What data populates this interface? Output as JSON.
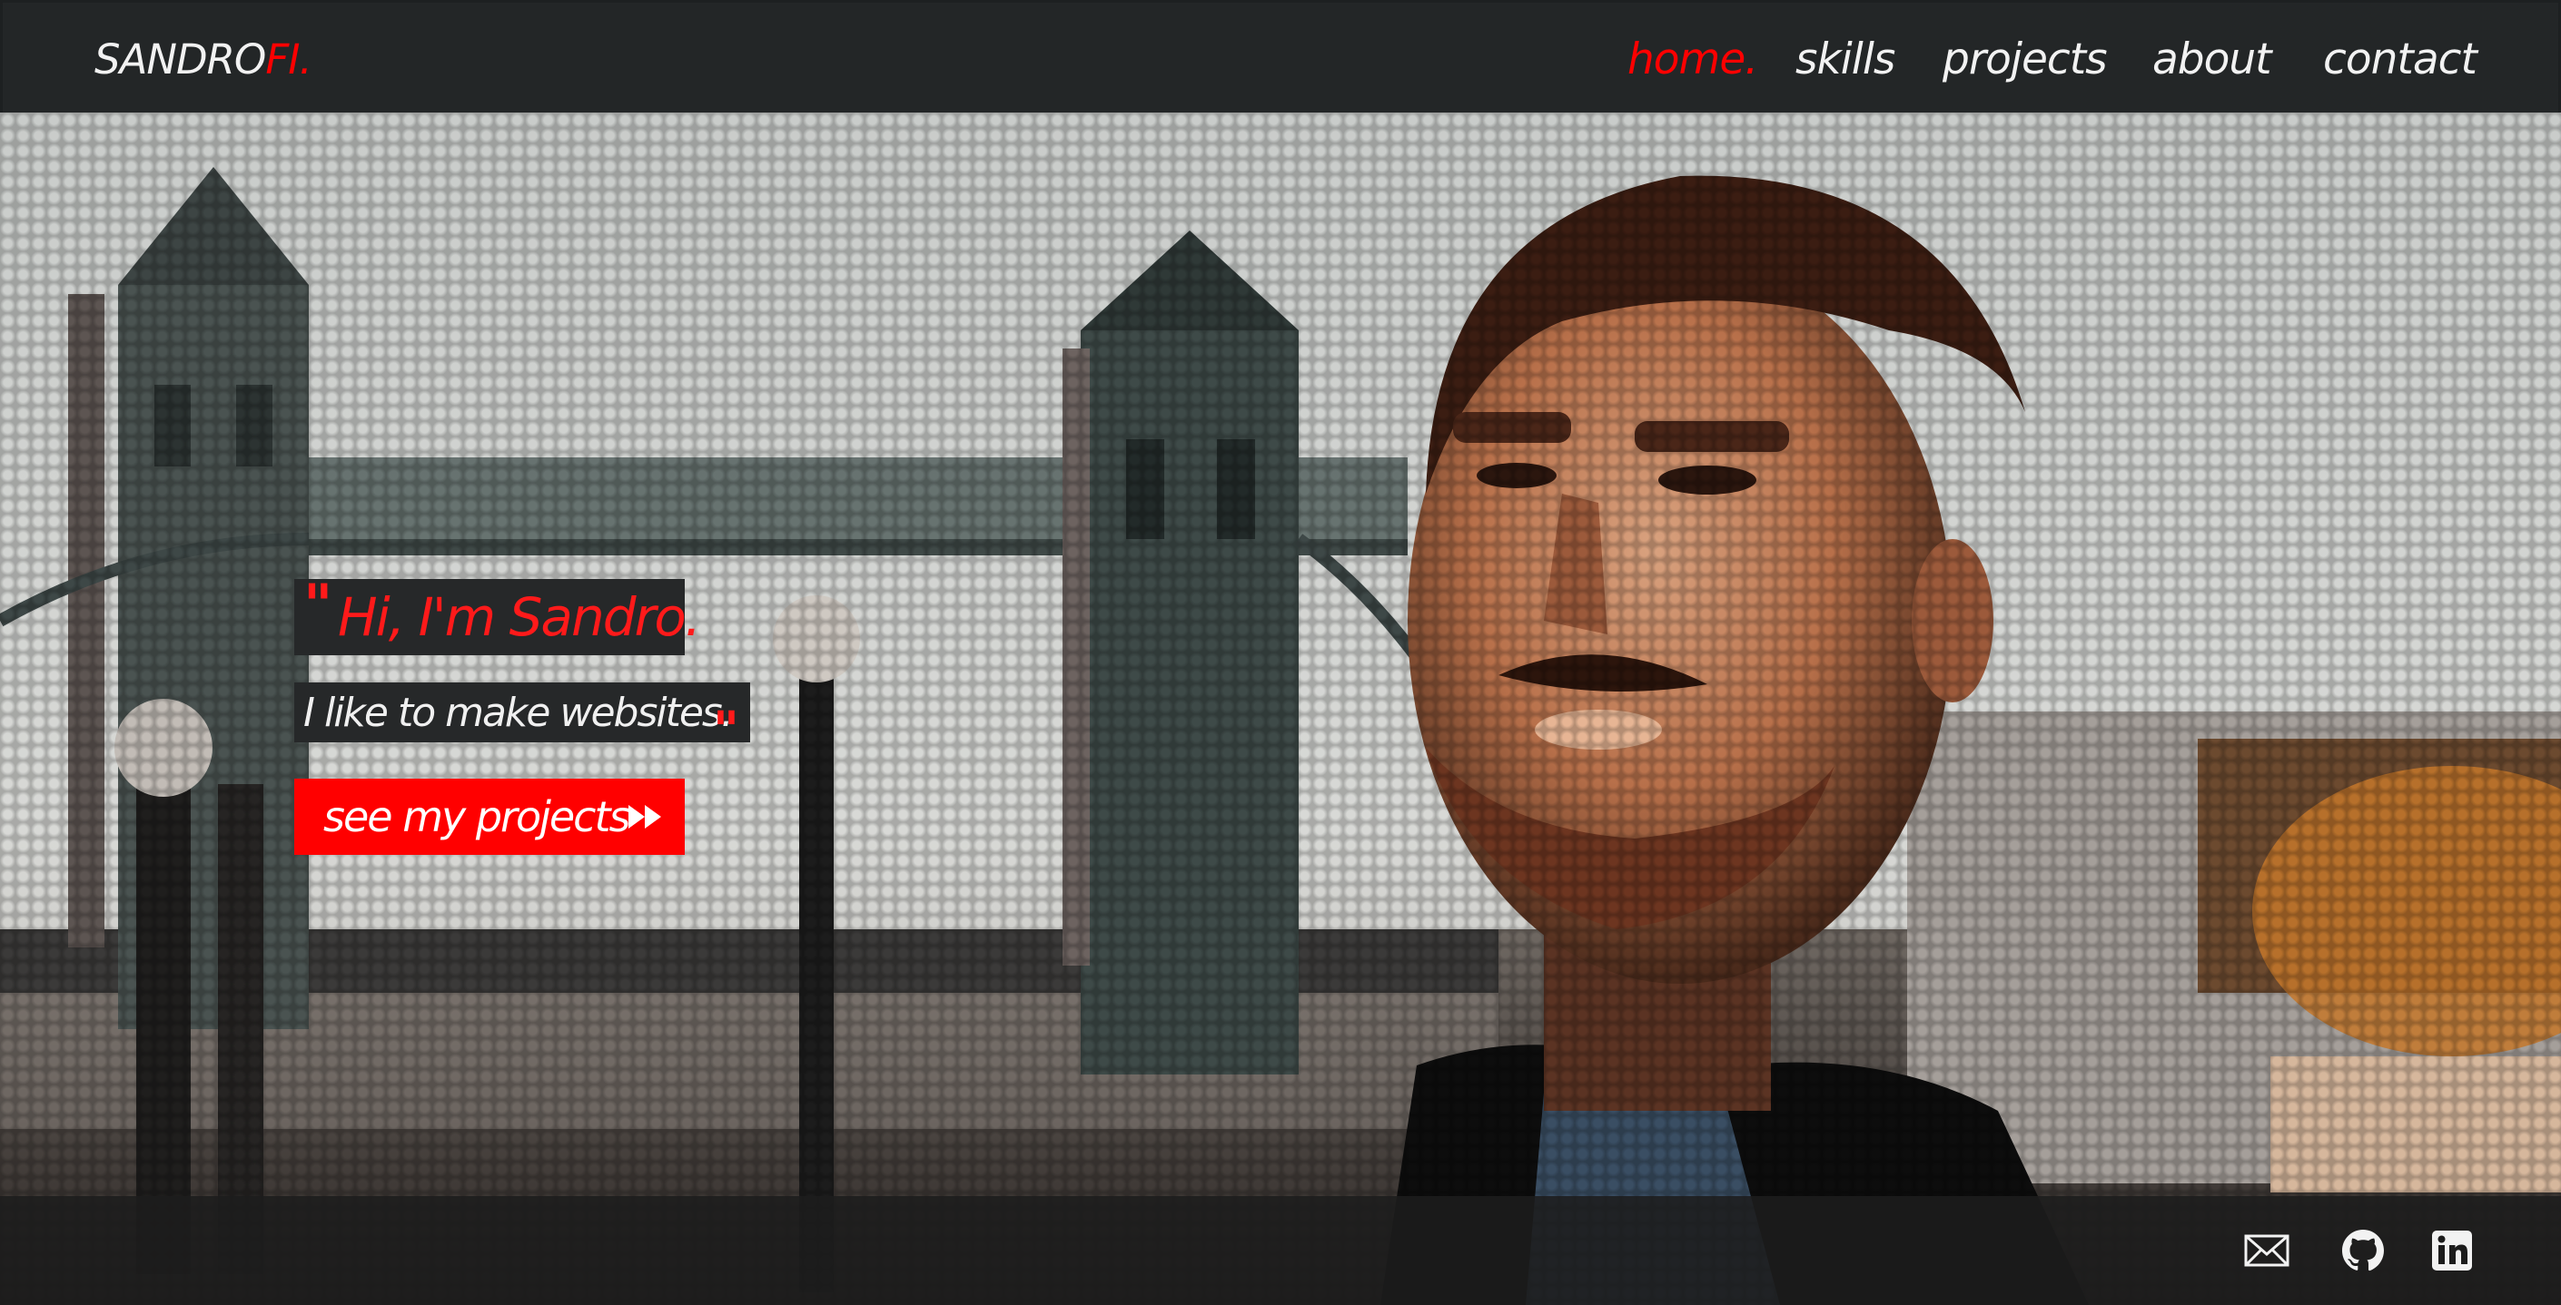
{
  "header": {
    "logo_main": "SANDRO",
    "logo_accent": "FI.",
    "nav": [
      {
        "label": "home.",
        "active": true
      },
      {
        "label": "skills",
        "active": false
      },
      {
        "label": "projects",
        "active": false
      },
      {
        "label": "about",
        "active": false
      },
      {
        "label": "contact",
        "active": false
      }
    ]
  },
  "hero": {
    "open_quote": "\"",
    "greeting": "Hi, I'm Sandro.",
    "tagline": "I like to make websites.",
    "close_quote": "\"",
    "cta_label": "see my projects",
    "cta_icon": "fast-forward-icon"
  },
  "footer": {
    "social": [
      {
        "name": "email-icon"
      },
      {
        "name": "github-icon"
      },
      {
        "name": "linkedin-icon"
      }
    ]
  },
  "colors": {
    "accent": "#ff0000",
    "header_bg": "#232627",
    "text_light": "#f2f2f2"
  }
}
